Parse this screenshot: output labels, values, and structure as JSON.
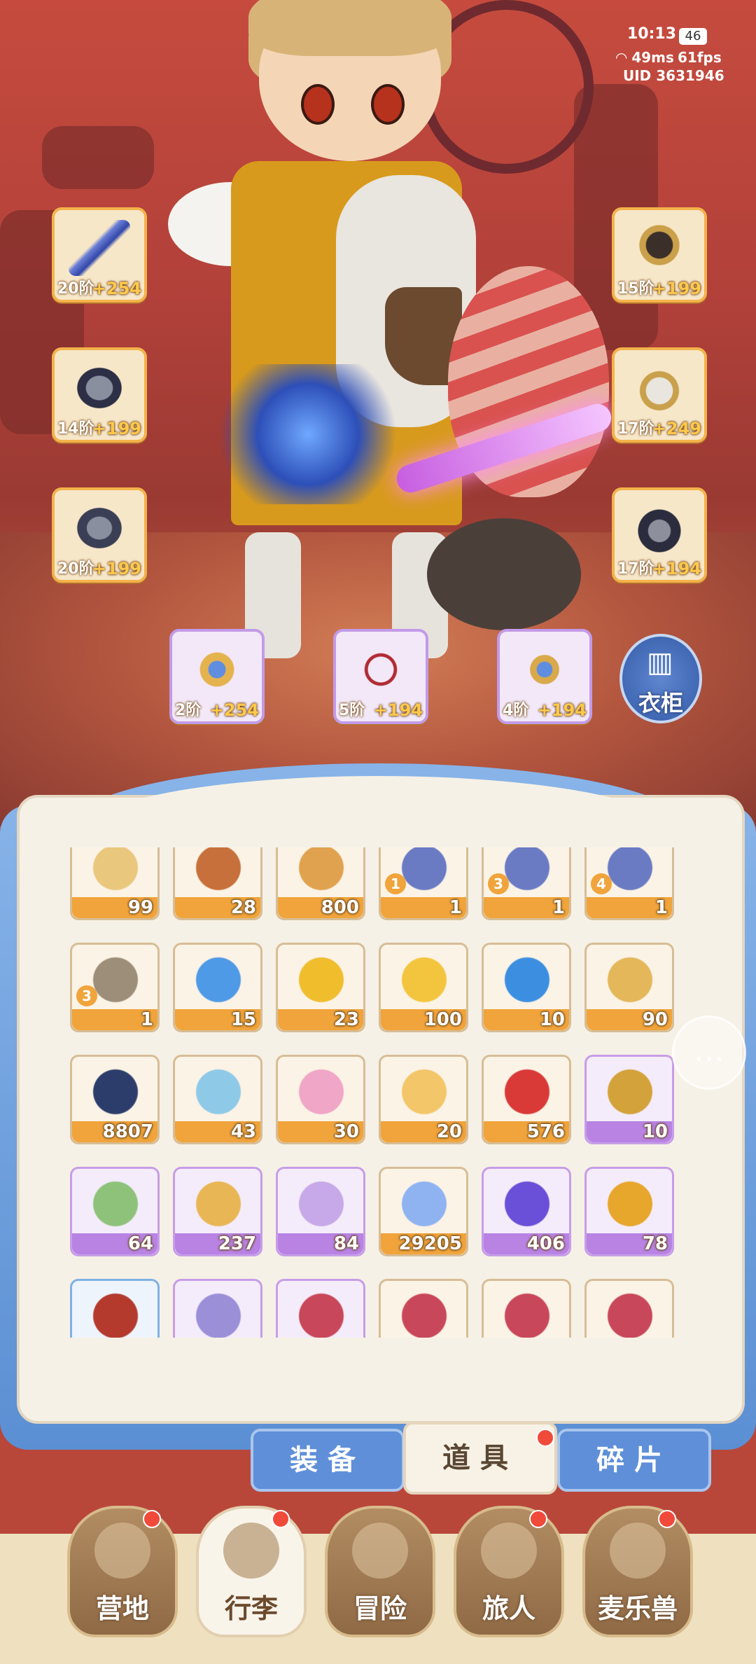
{
  "status": {
    "time": "10:13",
    "battery": "46",
    "ping": "49ms",
    "fps": "61fps",
    "uid": "UID 3631946"
  },
  "equipment": {
    "weapon": {
      "tier": "20阶",
      "plus": "+254"
    },
    "helmet": {
      "tier": "15阶",
      "plus": "+199"
    },
    "armor": {
      "tier": "14阶",
      "plus": "+199"
    },
    "gloves": {
      "tier": "17阶",
      "plus": "+249"
    },
    "pants": {
      "tier": "20阶",
      "plus": "+199"
    },
    "boots": {
      "tier": "17阶",
      "plus": "+194"
    },
    "ring": {
      "tier": "2阶",
      "plus": "+254"
    },
    "necklace": {
      "tier": "5阶",
      "plus": "+194"
    },
    "charm": {
      "tier": "4阶",
      "plus": "+194"
    }
  },
  "wardrobe": {
    "label": "衣柜",
    "icon": "wardrobe-icon"
  },
  "items": [
    {
      "count": "99",
      "color": "orange"
    },
    {
      "count": "28",
      "color": "orange"
    },
    {
      "count": "800",
      "color": "orange"
    },
    {
      "count": "1",
      "color": "orange",
      "badge": "1"
    },
    {
      "count": "1",
      "color": "orange",
      "badge": "3"
    },
    {
      "count": "1",
      "color": "orange",
      "badge": "4"
    },
    {
      "count": "1",
      "color": "orange",
      "badge": "3"
    },
    {
      "count": "15",
      "color": "orange"
    },
    {
      "count": "23",
      "color": "orange"
    },
    {
      "count": "100",
      "color": "orange"
    },
    {
      "count": "10",
      "color": "orange"
    },
    {
      "count": "90",
      "color": "orange"
    },
    {
      "count": "8807",
      "color": "orange"
    },
    {
      "count": "43",
      "color": "orange"
    },
    {
      "count": "30",
      "color": "orange"
    },
    {
      "count": "20",
      "color": "orange"
    },
    {
      "count": "576",
      "color": "orange"
    },
    {
      "count": "10",
      "color": "purple"
    },
    {
      "count": "64",
      "color": "purple"
    },
    {
      "count": "237",
      "color": "purple"
    },
    {
      "count": "84",
      "color": "purple"
    },
    {
      "count": "29205",
      "color": "orange"
    },
    {
      "count": "406",
      "color": "purple"
    },
    {
      "count": "78",
      "color": "purple"
    },
    {
      "count": "",
      "color": "blue"
    },
    {
      "count": "",
      "color": "purple"
    },
    {
      "count": "",
      "color": "purple"
    },
    {
      "count": "",
      "color": "orange"
    },
    {
      "count": "",
      "color": "orange"
    },
    {
      "count": "",
      "color": "orange"
    }
  ],
  "tabs": {
    "equipment": "装备",
    "items": "道具",
    "fragments": "碎片"
  },
  "nav": {
    "camp": "营地",
    "luggage": "行李",
    "adventure": "冒险",
    "traveler": "旅人",
    "pet": "麦乐兽"
  },
  "chat_icon": "chat-bubble-icon"
}
